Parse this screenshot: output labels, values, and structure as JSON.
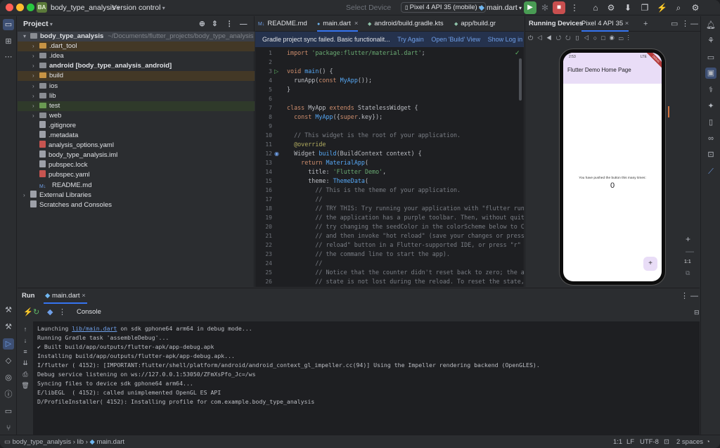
{
  "titlebar": {
    "project_badge": "BA",
    "project_name": "body_type_analysis",
    "vcs": "Version control",
    "select_device": "Select Device",
    "device": "Pixel 4 API 35 (mobile)",
    "run_config": "main.dart"
  },
  "project_panel": {
    "title": "Project",
    "tree": [
      {
        "label": "body_type_analysis",
        "suffix": "~/Documents/flutter_projects/body_type_analysis",
        "bold": true,
        "arrow": "▾",
        "indent": 0,
        "icon": "folder-icon",
        "color": "#8a8d93",
        "bg": "#3b3f46"
      },
      {
        "label": ".dart_tool",
        "arrow": "›",
        "indent": 1,
        "icon": "folder-icon",
        "color": "#c79344",
        "bg": "#433826"
      },
      {
        "label": ".idea",
        "arrow": "›",
        "indent": 1,
        "icon": "folder-icon",
        "color": "#8a8d93",
        "bg": ""
      },
      {
        "label": "android [body_type_analysis_android]",
        "bold": true,
        "arrow": "›",
        "indent": 1,
        "icon": "folder-icon",
        "color": "#8a8d93",
        "bg": ""
      },
      {
        "label": "build",
        "arrow": "›",
        "indent": 1,
        "icon": "folder-icon",
        "color": "#c79344",
        "bg": "#433826"
      },
      {
        "label": "ios",
        "arrow": "›",
        "indent": 1,
        "icon": "folder-icon",
        "color": "#8a8d93",
        "bg": ""
      },
      {
        "label": "lib",
        "arrow": "›",
        "indent": 1,
        "icon": "folder-icon",
        "color": "#8a8d93",
        "bg": ""
      },
      {
        "label": "test",
        "arrow": "›",
        "indent": 1,
        "icon": "folder-icon",
        "color": "#6a9a52",
        "bg": "#2f3a2a"
      },
      {
        "label": "web",
        "arrow": "›",
        "indent": 1,
        "icon": "folder-icon",
        "color": "#8a8d93",
        "bg": ""
      },
      {
        "label": ".gitignore",
        "arrow": "",
        "indent": 1,
        "icon": "file-icon",
        "color": "#9da0a8",
        "bg": ""
      },
      {
        "label": ".metadata",
        "arrow": "",
        "indent": 1,
        "icon": "file-icon",
        "color": "#9da0a8",
        "bg": ""
      },
      {
        "label": "analysis_options.yaml",
        "arrow": "",
        "indent": 1,
        "icon": "yaml-icon",
        "color": "#c75450",
        "bg": ""
      },
      {
        "label": "body_type_analysis.iml",
        "arrow": "",
        "indent": 1,
        "icon": "file-icon",
        "color": "#9da0a8",
        "bg": ""
      },
      {
        "label": "pubspec.lock",
        "arrow": "",
        "indent": 1,
        "icon": "file-icon",
        "color": "#9da0a8",
        "bg": ""
      },
      {
        "label": "pubspec.yaml",
        "arrow": "",
        "indent": 1,
        "icon": "yaml-icon",
        "color": "#c75450",
        "bg": ""
      },
      {
        "label": "README.md",
        "arrow": "",
        "indent": 1,
        "icon": "markdown-icon",
        "color": "#6f9fe8",
        "bg": ""
      },
      {
        "label": "External Libraries",
        "arrow": "›",
        "indent": 0,
        "icon": "library-icon",
        "color": "#9da0a8",
        "bg": ""
      },
      {
        "label": "Scratches and Consoles",
        "arrow": "",
        "indent": 0,
        "icon": "scratch-icon",
        "color": "#9da0a8",
        "bg": ""
      }
    ]
  },
  "editor": {
    "tabs": [
      {
        "label": "README.md",
        "icon": "M↓"
      },
      {
        "label": "main.dart",
        "icon": "●",
        "active": true
      },
      {
        "label": "android/build.gradle.kts",
        "icon": "◆"
      },
      {
        "label": "app/build.gr",
        "icon": "◆"
      }
    ],
    "banner": {
      "text": "Gradle project sync failed. Basic functionalit...",
      "links": [
        "Try Again",
        "Open 'Build' View",
        "Show Log in Finder"
      ]
    },
    "lines": [
      {
        "n": "1",
        "html": "<span class=\"kw\">import</span> <span class=\"str\">'package:flutter/material.dart'</span>;"
      },
      {
        "n": "2",
        "html": ""
      },
      {
        "n": "3",
        "html": "<span class=\"kw\">void</span> <span class=\"fn\">main</span>() {"
      },
      {
        "n": "4",
        "html": "  runApp(<span class=\"kw\">const</span> <span class=\"cls\">MyApp</span>());"
      },
      {
        "n": "5",
        "html": "}"
      },
      {
        "n": "6",
        "html": ""
      },
      {
        "n": "7",
        "html": "<span class=\"kw\">class</span> MyApp <span class=\"kw\">extends</span> StatelessWidget {"
      },
      {
        "n": "8",
        "html": "  <span class=\"kw\">const</span> <span class=\"cls\">MyApp</span>({<span class=\"kw\">super</span>.key});"
      },
      {
        "n": "9",
        "html": ""
      },
      {
        "n": "10",
        "html": "  <span class=\"cm\">// This widget is the root of your application.</span>"
      },
      {
        "n": "11",
        "html": "  <span class=\"an\">@override</span>"
      },
      {
        "n": "12",
        "html": "  Widget <span class=\"fn\">build</span>(BuildContext context) {"
      },
      {
        "n": "13",
        "html": "    <span class=\"kw\">return</span> <span class=\"cls\">MaterialApp</span>("
      },
      {
        "n": "14",
        "html": "      title: <span class=\"str\">'Flutter Demo'</span>,"
      },
      {
        "n": "15",
        "html": "      theme: <span class=\"cls\">ThemeData</span>("
      },
      {
        "n": "16",
        "html": "        <span class=\"cm\">// This is the theme of your application.</span>"
      },
      {
        "n": "17",
        "html": "        <span class=\"cm\">//</span>"
      },
      {
        "n": "18",
        "html": "        <span class=\"cm\">// TRY THIS: Try running your application with \"flutter run\". You</span>"
      },
      {
        "n": "19",
        "html": "        <span class=\"cm\">// the application has a purple toolbar. Then, without quitting t</span>"
      },
      {
        "n": "20",
        "html": "        <span class=\"cm\">// try changing the seedColor in the colorScheme below to Colors.</span>"
      },
      {
        "n": "21",
        "html": "        <span class=\"cm\">// and then invoke \"hot reload\" (save your changes or press the \"</span>"
      },
      {
        "n": "22",
        "html": "        <span class=\"cm\">// reload\" button in a Flutter-supported IDE, or press \"r\" if you</span>"
      },
      {
        "n": "23",
        "html": "        <span class=\"cm\">// the command line to start the app).</span>"
      },
      {
        "n": "24",
        "html": "        <span class=\"cm\">//</span>"
      },
      {
        "n": "25",
        "html": "        <span class=\"cm\">// Notice that the counter didn't reset back to zero; the applica</span>"
      },
      {
        "n": "26",
        "html": "        <span class=\"cm\">// state is not lost during the reload. To reset the state, use h</span>"
      }
    ]
  },
  "devices": {
    "title": "Running Devices",
    "tab": "Pixel 4 API 35",
    "phone": {
      "status_time": "2:53",
      "status_right": "LTE",
      "debug_ribbon": "DEBUG",
      "appbar_title": "Flutter Demo Home Page",
      "message": "You have pushed the button this many times:",
      "counter": "0",
      "fab": "+"
    },
    "zoom_ratio": "1:1"
  },
  "run_panel": {
    "title": "Run",
    "tab": "main.dart",
    "console_label": "Console",
    "lines": [
      {
        "pre": "Launching ",
        "link": "lib/main.dart",
        "post": " on sdk gphone64 arm64 in debug mode..."
      },
      {
        "pre": "Running Gradle task 'assembleDebug'...",
        "link": "",
        "post": ""
      },
      {
        "pre": "✔ Built build/app/outputs/flutter-apk/app-debug.apk",
        "link": "",
        "post": ""
      },
      {
        "pre": "Installing build/app/outputs/flutter-apk/app-debug.apk...",
        "link": "",
        "post": ""
      },
      {
        "pre": "I/flutter ( 4152): [IMPORTANT:flutter/shell/platform/android/android_context_gl_impeller.cc(94)] Using the Impeller rendering backend (OpenGLES).",
        "link": "",
        "post": ""
      },
      {
        "pre": "Debug service listening on ws://127.0.0.1:53050/ZFmXsPfo_Jc=/ws",
        "link": "",
        "post": ""
      },
      {
        "pre": "Syncing files to device sdk gphone64 arm64...",
        "link": "",
        "post": ""
      },
      {
        "pre": "E/libEGL  ( 4152): called unimplemented OpenGL ES API",
        "link": "",
        "post": ""
      },
      {
        "pre": "D/ProfileInstaller( 4152): Installing profile for com.example.body_type_analysis",
        "link": "",
        "post": ""
      }
    ]
  },
  "statusbar": {
    "crumbs": [
      "body_type_analysis",
      "lib",
      "main.dart"
    ],
    "position": "1:1",
    "line_sep": "LF",
    "encoding": "UTF-8",
    "indent": "2 spaces"
  }
}
